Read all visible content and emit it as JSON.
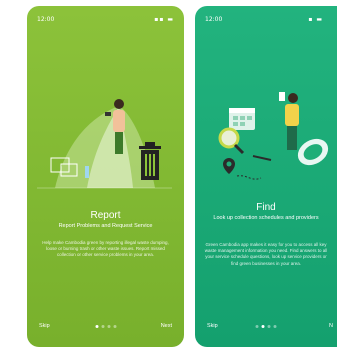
{
  "colors": {
    "report_bg": "#8cc23a",
    "find_bg": "#1fae78",
    "text": "#ffffff"
  },
  "screens": [
    {
      "time": "12:00",
      "title": "Report",
      "subtitle": "Report Problems and Request Service",
      "body": "Help make Cambodia green by reporting illegal waste dumping, loose or burning trash or other waste issues. Report missed collection or other service problems in your area.",
      "skip": "Skip",
      "next": "Next",
      "page_index": 0,
      "page_count": 4
    },
    {
      "time": "12:00",
      "title": "Find",
      "subtitle": "Look up collection schedules and providers",
      "body": "Green Cambodia app makes it easy for you to access all key waste management information you need. Find answers to all your service schedule questions, look up service providers or find green businesses in your area.",
      "skip": "Skip",
      "next": "N",
      "page_index": 1,
      "page_count": 4
    }
  ],
  "icons": [
    "signal-icon",
    "wifi-icon",
    "battery-icon",
    "trash-bin-icon",
    "calendar-icon",
    "magnifier-icon",
    "map-pin-icon"
  ]
}
